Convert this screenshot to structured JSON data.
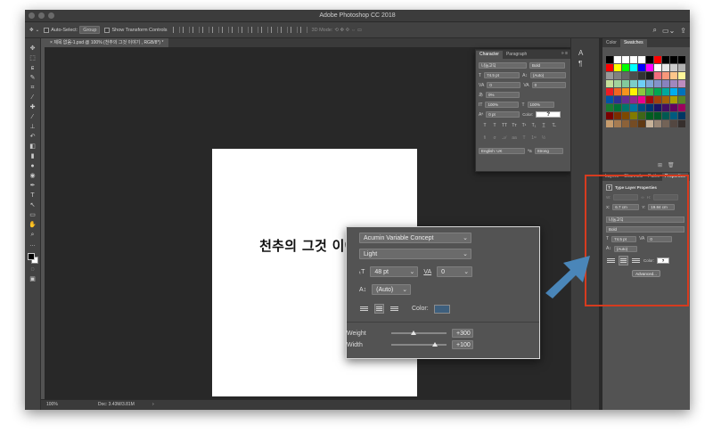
{
  "app": {
    "title": "Adobe Photoshop CC 2018"
  },
  "options_bar": {
    "auto_select_label": "Auto-Select:",
    "auto_select_value": "Group",
    "transform_label": "Show Transform Controls",
    "mode_3d": "3D Mode:"
  },
  "document": {
    "tab_title": "제목 없음-1.psd @ 100% (천추의 그것 이야기 , RGB/8*) *",
    "canvas_text": "천추의 그것 이야기"
  },
  "status": {
    "zoom": "100%",
    "doc": "Doc: 3.43M/3.81M",
    "arrow": "›"
  },
  "character_panel": {
    "tabs": [
      "Character",
      "Paragraph"
    ],
    "menu_glyph": "≡",
    "font_family": "나눔고딕",
    "font_style": "Bold",
    "size": "74.5 pt",
    "leading": "(Auto)",
    "kerning": "0",
    "tracking": "0",
    "tsume": "0%",
    "vscale": "100%",
    "hscale": "100%",
    "baseline": "0 pt",
    "color_label": "Color:",
    "color_value": "?",
    "language": "English: UK",
    "aa_label": "ªa",
    "antialias": "Strong"
  },
  "right_panel": {
    "top_tabs": [
      "Color",
      "Swatches"
    ],
    "bottom_tabs": [
      "Layers",
      "Channels",
      "Paths",
      "Properties"
    ],
    "props_title": "Type Layer Properties",
    "w_label": "W:",
    "h_label": "H:",
    "x_label": "X:",
    "x_value": "6.7 cm",
    "y_label": "Y:",
    "y_value": "19.84 cm",
    "font_family": "나눔고딕",
    "font_style": "Bold",
    "size": "74.5 pt",
    "tracking": "0",
    "leading": "(Auto)",
    "color_label": "Color:",
    "color_value": "?",
    "advanced_label": "Advanced..."
  },
  "zoom_panel": {
    "font_family": "Acumin Variable Concept",
    "font_style": "Light",
    "size": "48 pt",
    "tracking": "0",
    "leading": "(Auto)",
    "color_label": "Color:",
    "weight_label": "Weight",
    "weight_value": "+300",
    "width_label": "Width",
    "width_value": "+100"
  },
  "colors": {
    "highlight_border": "#d63b1f",
    "callout_arrow": "#4a86b9",
    "zoom_color_swatch": "#3e5f7d"
  },
  "swatches": [
    "#000000",
    "#ffffff",
    "#ffffff",
    "#ffffff",
    "#ffffff",
    "#000000",
    "#ff0000",
    "#000000",
    "#000000",
    "#000000",
    "#ff0000",
    "#ffff00",
    "#00ff00",
    "#00ffff",
    "#0000ff",
    "#ff00ff",
    "#ffffff",
    "#e6e6e6",
    "#cccccc",
    "#b3b3b3",
    "#999999",
    "#808080",
    "#666666",
    "#4d4d4d",
    "#333333",
    "#1a1a1a",
    "#f26d7d",
    "#f7977a",
    "#fdc68a",
    "#fff79a",
    "#c4df9b",
    "#a2d39c",
    "#82ca9d",
    "#7bcdc8",
    "#6ecff6",
    "#7ea7d8",
    "#8393ca",
    "#8882be",
    "#a187be",
    "#bc8dbf",
    "#ed1c24",
    "#f26522",
    "#f7941d",
    "#fff200",
    "#8dc63f",
    "#39b54a",
    "#00a651",
    "#00a99d",
    "#00aeef",
    "#0072bc",
    "#0054a6",
    "#2e3192",
    "#662d91",
    "#92278f",
    "#ec008c",
    "#9e0b0f",
    "#a0410d",
    "#a36209",
    "#aba000",
    "#598527",
    "#1a7b30",
    "#007236",
    "#00746b",
    "#0076a3",
    "#004b80",
    "#003471",
    "#1b1464",
    "#440e62",
    "#630460",
    "#9e005d",
    "#790000",
    "#7b2e00",
    "#7d4900",
    "#827b00",
    "#406618",
    "#005e20",
    "#005826",
    "#005952",
    "#005b7f",
    "#003663",
    "#c69c6d",
    "#a67c52",
    "#8c6239",
    "#754c24",
    "#603913",
    "#c7b299",
    "#998675",
    "#736357",
    "#534741",
    "#362f2d"
  ]
}
